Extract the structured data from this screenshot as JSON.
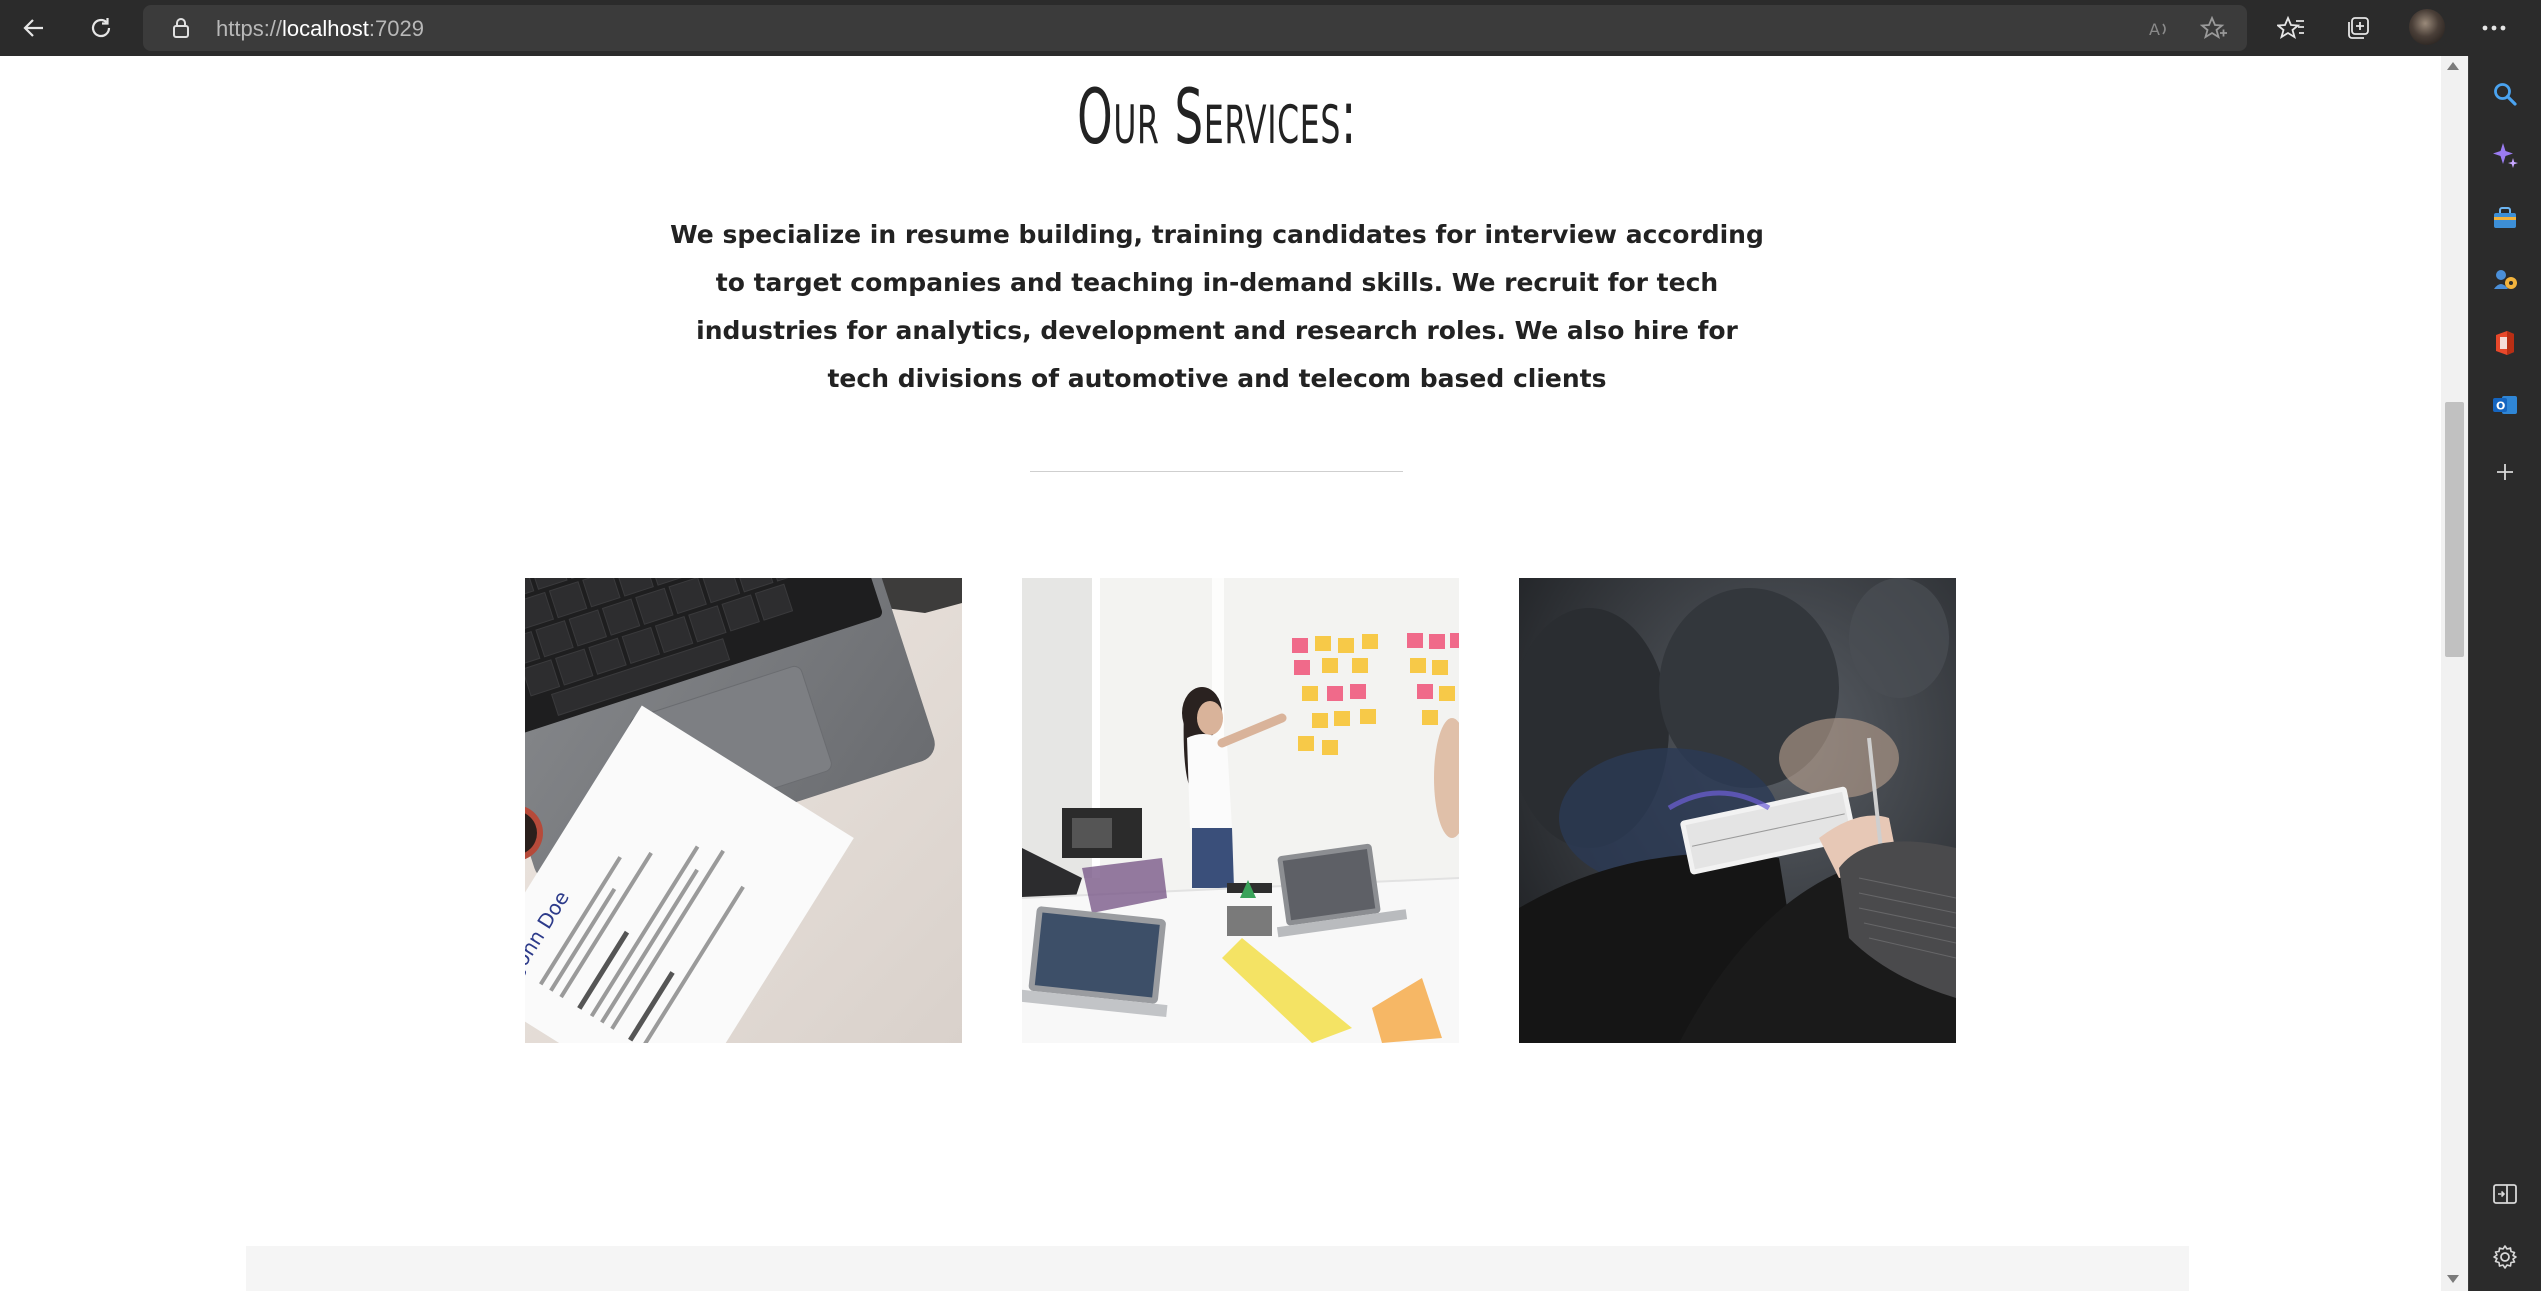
{
  "browser": {
    "url_scheme": "https://",
    "url_host": "localhost",
    "url_port": ":7029",
    "icons": [
      "back-icon",
      "refresh-icon",
      "lock-icon",
      "read-aloud-icon",
      "add-favorite-icon",
      "favorites-icon",
      "collections-icon",
      "profile-avatar",
      "more-icon"
    ]
  },
  "sidebar": {
    "icons": [
      "search-icon",
      "copilot-icon",
      "shopping-icon",
      "games-icon",
      "office-icon",
      "outlook-icon",
      "add-icon",
      "split-screen-icon",
      "settings-icon"
    ]
  },
  "services": {
    "title": "Our Services:",
    "description": "We specialize in resume building, training candidates for interview according to target companies and teaching in-demand skills. We recruit for tech industries for analytics, development and research roles. We also hire for tech divisions of automotive and telecom based clients"
  },
  "images": [
    {
      "name": "resume-laptop-photo"
    },
    {
      "name": "meeting-sticky-notes-photo"
    },
    {
      "name": "seminar-notebook-photo"
    }
  ],
  "colors": {
    "browser_bar": "#2b2b2b",
    "address_bar": "#3b3b3b",
    "page_background": "#ffffff",
    "text": "#222222",
    "divider": "#cfcfcf"
  }
}
